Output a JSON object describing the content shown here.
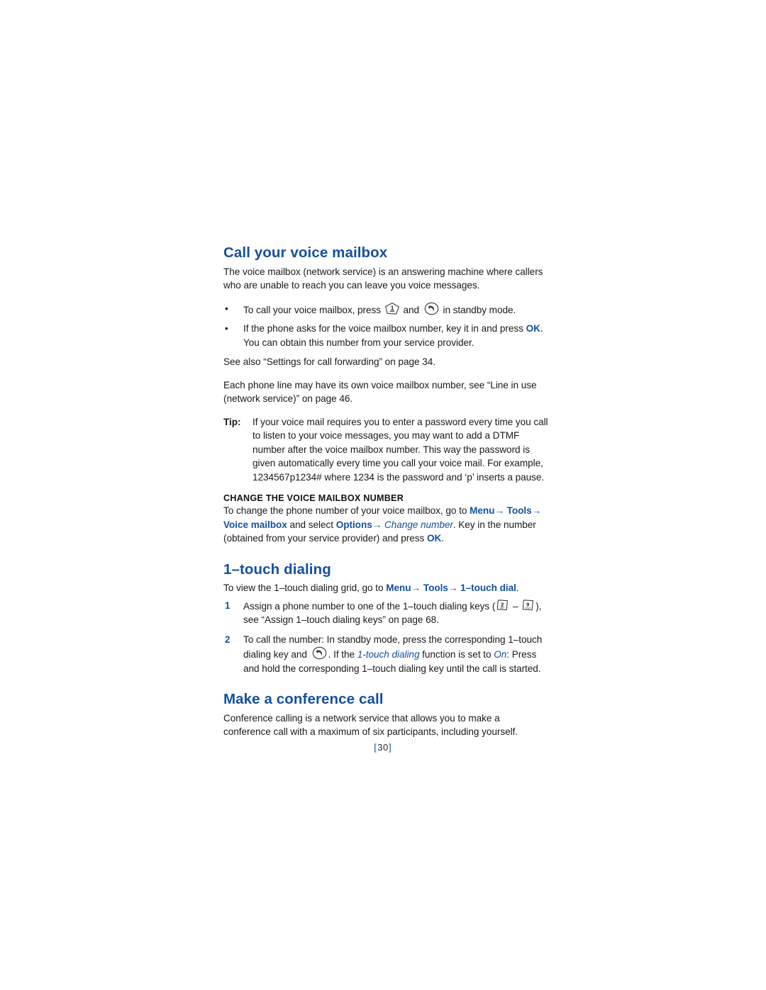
{
  "document": {
    "page_number": "30",
    "page_number_display": "[ 30 ]",
    "bracket_left": "[",
    "bracket_right": "]",
    "accent_color": "#15509e",
    "body_color": "#1a1a1a"
  },
  "sections": {
    "voice_mailbox": {
      "heading": "Call your voice mailbox",
      "intro": "The voice mailbox (network service) is an answering machine where callers who are unable to reach you can leave you voice messages.",
      "bullets": [
        {
          "parts": [
            {
              "type": "text",
              "value": "To call your voice mailbox, press "
            },
            {
              "type": "icon",
              "value": "key-1-icon"
            },
            {
              "type": "text",
              "value": " and "
            },
            {
              "type": "icon",
              "value": "call-key-icon"
            },
            {
              "type": "text",
              "value": " in standby mode."
            }
          ],
          "plain": "To call your voice mailbox, press (1) and (call) in standby mode."
        },
        {
          "parts": [
            {
              "type": "text",
              "value": "If the phone asks for the voice mailbox number, key it in and press "
            },
            {
              "type": "ui-bold",
              "value": "OK"
            },
            {
              "type": "text",
              "value": ". You can obtain this number from your service provider."
            }
          ],
          "plain": "If the phone asks for the voice mailbox number, key it in and press OK. You can obtain this number from your service provider."
        }
      ],
      "see_also": "See also “Settings for call forwarding” on page 34.",
      "line_in_use": "Each phone line may have its own voice mailbox number, see “Line in use (network service)” on page 46.",
      "tip": {
        "label": "Tip:",
        "text": "If your voice mail requires you to enter a password every time you call to listen to your voice messages, you may want to add a DTMF number after the voice mailbox number. This way the password is given automatically every time you call your voice mail. For example, 1234567p1234# where 1234 is the password and ‘p’ inserts a pause."
      },
      "change_number": {
        "heading": "CHANGE THE VOICE MAILBOX NUMBER",
        "text_1": "To change the phone number of your voice mailbox, go to ",
        "menu": "Menu",
        "arrow_1": "→",
        "tools": "Tools",
        "arrow_2": "→",
        "voice_mailbox": "Voice mailbox",
        "text_2": " and select ",
        "options": "Options",
        "arrow_3": "→",
        "change_number_italic": "Change number",
        "text_3": ". Key in the number (obtained from your service provider) and press ",
        "ok": "OK",
        "text_4": "."
      }
    },
    "one_touch_dialing": {
      "heading": "1–touch dialing",
      "intro_1": "To view the 1–touch dialing grid, go to ",
      "menu": "Menu",
      "arrow_1": "→",
      "tools": "Tools",
      "arrow_2": "→",
      "one_touch_dial": "1–touch dial",
      "intro_2": ".",
      "steps": [
        {
          "number": "1",
          "text_1": "Assign a phone number to one of the 1–touch dialing keys (",
          "key_from": {
            "digit": "2",
            "letters": "abc"
          },
          "separator": " – ",
          "key_to": {
            "digit": "9",
            "letters": "wxyz"
          },
          "text_2": "), see “Assign 1–touch dialing keys” on page 68.",
          "plain": "Assign a phone number to one of the 1-touch dialing keys (2abc - 9wxyz), see “Assign 1-touch dialing keys” on page 68."
        },
        {
          "number": "2",
          "text_1": "To call the number: In standby mode, press the corresponding 1–touch dialing key and ",
          "icon": "call-key-icon",
          "text_2": ". If the ",
          "italic_1": "1-touch dialing",
          "text_3": " function is set to ",
          "italic_2": "On",
          "text_4": ": Press and hold the corresponding 1–touch dialing key until the call is started.",
          "plain": "To call the number: In standby mode, press the corresponding 1-touch dialing key and (call). If the 1-touch dialing function is set to On: Press and hold the corresponding 1-touch dialing key until the call is started."
        }
      ]
    },
    "conference_call": {
      "heading": "Make a conference call",
      "text": "Conference calling is a network service that allows you to make a conference call with a maximum of six participants, including yourself."
    }
  }
}
